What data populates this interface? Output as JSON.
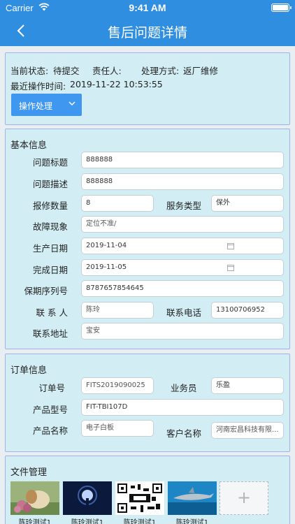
{
  "status_bar": {
    "carrier": "Carrier",
    "time": "9:41 AM",
    "battery_level": 0.9
  },
  "navbar": {
    "title": "售后问题详情",
    "back_icon": "chevron-left-icon"
  },
  "status_card": {
    "current_status_label": "当前状态:",
    "current_status_value": "待提交",
    "owner_label": "责任人:",
    "owner_value": "",
    "handling_label": "处理方式:",
    "handling_value": "返厂维修",
    "last_op_label": "最近操作时间:",
    "last_op_value": "2019-11-22 10:53:55",
    "action_button": "操作处理"
  },
  "basic_info": {
    "title": "基本信息",
    "issue_title_label": "问题标题",
    "issue_title_value": "888888",
    "issue_desc_label": "问题描述",
    "issue_desc_value": "888888",
    "repair_qty_label": "报修数量",
    "repair_qty_value": "8",
    "service_type_label": "服务类型",
    "service_type_value": "保外",
    "fault_label": "故障现象",
    "fault_value": "定位不准/",
    "prod_date_label": "生产日期",
    "prod_date_value": "2019-11-04",
    "done_date_label": "完成日期",
    "done_date_value": "2019-11-05",
    "warranty_label": "保期序列号",
    "warranty_value": "8787657854645",
    "contact_label": "联 系 人",
    "contact_value": "陈玲",
    "phone_label": "联系电话",
    "phone_value": "13100706952",
    "address_label": "联系地址",
    "address_value": "宝安"
  },
  "order_info": {
    "title": "订单信息",
    "order_no_label": "订单号",
    "order_no_value": "FITS2019090025",
    "sales_label": "业务员",
    "sales_value": "乐盈",
    "model_label": "产品型号",
    "model_value": "FIT-TBI107D",
    "product_name_label": "产品名称",
    "product_name_value": "电子白板",
    "customer_label": "客户名称",
    "customer_value": "河南宏昌科技有限..."
  },
  "files": {
    "title": "文件管理",
    "items": [
      {
        "caption": "陈玲测试1"
      },
      {
        "caption": "陈玲测试1"
      },
      {
        "caption": "陈玲测试1"
      },
      {
        "caption": "陈玲测试1"
      }
    ],
    "add_icon": "plus-icon"
  }
}
